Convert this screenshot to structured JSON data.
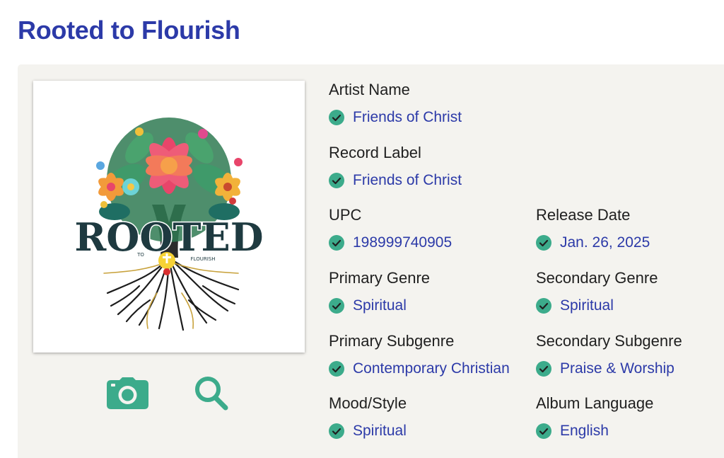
{
  "page": {
    "title": "Rooted to Flourish"
  },
  "colors": {
    "title": "#2c3aa8",
    "value": "#2c3aa8",
    "check": "#3cab8b",
    "panel": "#f4f3ef"
  },
  "cover": {
    "logo_text": "ROOTED",
    "logo_small_left": "TO",
    "logo_small_right": "FLOURISH"
  },
  "actions": {
    "camera_icon": "camera-icon",
    "zoom_icon": "magnifier-icon"
  },
  "fields": {
    "artist_name": {
      "label": "Artist Name",
      "value": "Friends of Christ"
    },
    "record_label": {
      "label": "Record Label",
      "value": "Friends of Christ"
    },
    "upc": {
      "label": "UPC",
      "value": "198999740905"
    },
    "release_date": {
      "label": "Release Date",
      "value": "Jan. 26, 2025"
    },
    "primary_genre": {
      "label": "Primary Genre",
      "value": "Spiritual"
    },
    "secondary_genre": {
      "label": "Secondary Genre",
      "value": "Spiritual"
    },
    "primary_subgenre": {
      "label": "Primary Subgenre",
      "value": "Contemporary Christian"
    },
    "secondary_subgenre": {
      "label": "Secondary Subgenre",
      "value": "Praise & Worship"
    },
    "mood_style": {
      "label": "Mood/Style",
      "value": "Spiritual"
    },
    "album_language": {
      "label": "Album Language",
      "value": "English"
    }
  }
}
